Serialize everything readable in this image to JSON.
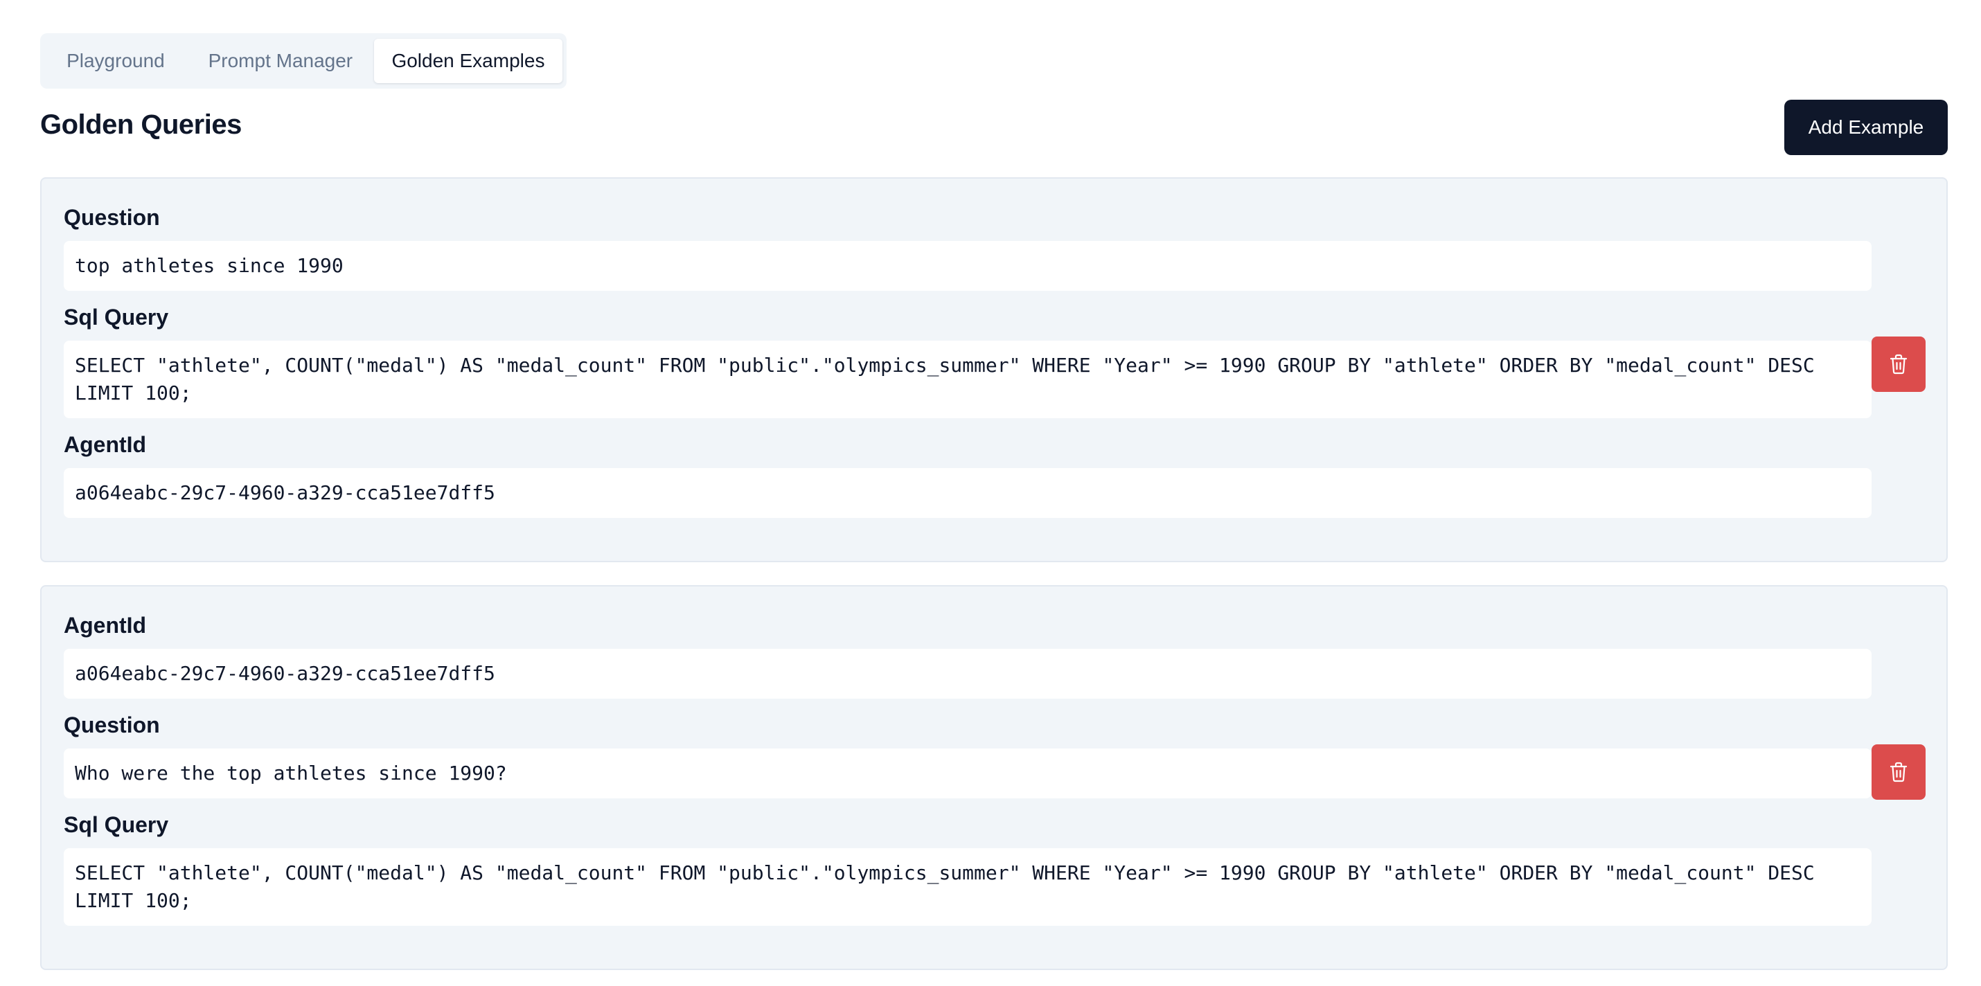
{
  "tabs": [
    {
      "label": "Playground",
      "active": false
    },
    {
      "label": "Prompt Manager",
      "active": false
    },
    {
      "label": "Golden Examples",
      "active": true
    }
  ],
  "header": {
    "title": "Golden Queries",
    "add_button_label": "Add Example"
  },
  "examples": [
    {
      "fields": [
        {
          "label": "Question",
          "value": "top athletes since 1990"
        },
        {
          "label": "Sql Query",
          "value": "SELECT \"athlete\", COUNT(\"medal\") AS \"medal_count\" FROM \"public\".\"olympics_summer\" WHERE \"Year\" >= 1990 GROUP BY \"athlete\" ORDER BY \"medal_count\" DESC\nLIMIT 100;"
        },
        {
          "label": "AgentId",
          "value": "a064eabc-29c7-4960-a329-cca51ee7dff5"
        }
      ],
      "delete_icon": "trash-icon"
    },
    {
      "fields": [
        {
          "label": "AgentId",
          "value": "a064eabc-29c7-4960-a329-cca51ee7dff5"
        },
        {
          "label": "Question",
          "value": "Who were the top athletes since 1990?"
        },
        {
          "label": "Sql Query",
          "value": "SELECT \"athlete\", COUNT(\"medal\") AS \"medal_count\" FROM \"public\".\"olympics_summer\" WHERE \"Year\" >= 1990 GROUP BY \"athlete\" ORDER BY \"medal_count\" DESC\nLIMIT 100;"
        }
      ],
      "delete_icon": "trash-icon"
    }
  ],
  "colors": {
    "primary_button": "#0f172a",
    "destructive_button": "#dc4c4c",
    "card_background": "#f1f5f9"
  }
}
